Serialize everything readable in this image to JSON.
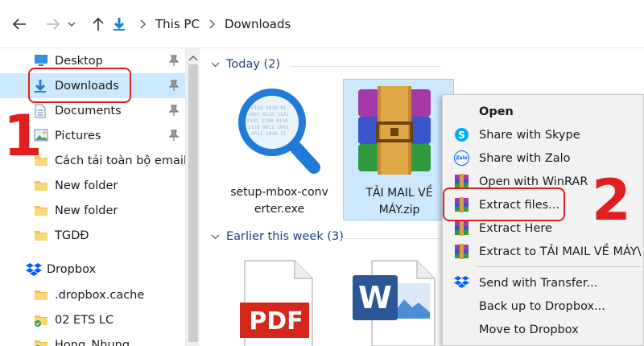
{
  "address_bar": {
    "breadcrumbs": [
      "This PC",
      "Downloads"
    ]
  },
  "nav_pane": {
    "items": [
      {
        "label": "Desktop",
        "icon": "desktop-icon",
        "pinned": true
      },
      {
        "label": "Downloads",
        "icon": "download-arrow-icon",
        "pinned": true,
        "selected": true
      },
      {
        "label": "Documents",
        "icon": "documents-icon",
        "pinned": true
      },
      {
        "label": "Pictures",
        "icon": "pictures-icon",
        "pinned": true
      },
      {
        "label": "Cách tải toàn bộ email",
        "icon": "folder-icon"
      },
      {
        "label": "New folder",
        "icon": "folder-icon"
      },
      {
        "label": "New folder",
        "icon": "folder-icon"
      },
      {
        "label": "TGDĐ",
        "icon": "folder-icon"
      },
      {
        "label": "Dropbox",
        "icon": "dropbox-icon"
      },
      {
        "label": ".dropbox.cache",
        "icon": "folder-icon"
      },
      {
        "label": "02 ETS LC",
        "icon": "synced-folder-icon"
      },
      {
        "label": "Hong_Nhung",
        "icon": "synced-folder-icon"
      }
    ]
  },
  "content": {
    "groups": [
      {
        "header": "Today (2)"
      },
      {
        "header": "Earlier this week (3)"
      }
    ],
    "files": [
      {
        "name_line1": "setup-mbox-conv",
        "name_line2": "erter.exe",
        "icon": "mbox-magnifier-icon"
      },
      {
        "name_line1": "TẢI MAIL VỀ",
        "name_line2": "MÁY.zip",
        "icon": "winrar-archive-icon",
        "selected": true
      },
      {
        "name_line1": "",
        "name_line2": "",
        "icon": "pdf-file-icon",
        "badge": "PDF"
      },
      {
        "name_line1": "",
        "name_line2": "",
        "icon": "word-file-icon",
        "badge": "W"
      }
    ]
  },
  "context_menu": {
    "items": [
      {
        "label": "Open",
        "bold": true,
        "icon": ""
      },
      {
        "label": "Share with Skype",
        "icon": "skype-icon"
      },
      {
        "label": "Share with Zalo",
        "icon": "zalo-icon",
        "icon_text": "Zalo"
      },
      {
        "label": "Open with WinRAR",
        "icon": "winrar-icon"
      },
      {
        "label": "Extract files...",
        "icon": "winrar-icon"
      },
      {
        "label": "Extract Here",
        "icon": "winrar-icon"
      },
      {
        "label": "Extract to TẢI MAIL VỀ MÁY\\",
        "icon": "winrar-icon"
      },
      {
        "label": "Send with Transfer...",
        "icon": "dropbox-icon"
      },
      {
        "label": "Back up to Dropbox...",
        "icon": ""
      },
      {
        "label": "Move to Dropbox",
        "icon": ""
      }
    ]
  },
  "annotations": {
    "step1": "1",
    "step2": "2"
  },
  "colors": {
    "selection": "#cce8ff",
    "accent_blue": "#0078d7",
    "annotation_red": "#e02020",
    "menu_bg": "#f2f2f2"
  }
}
